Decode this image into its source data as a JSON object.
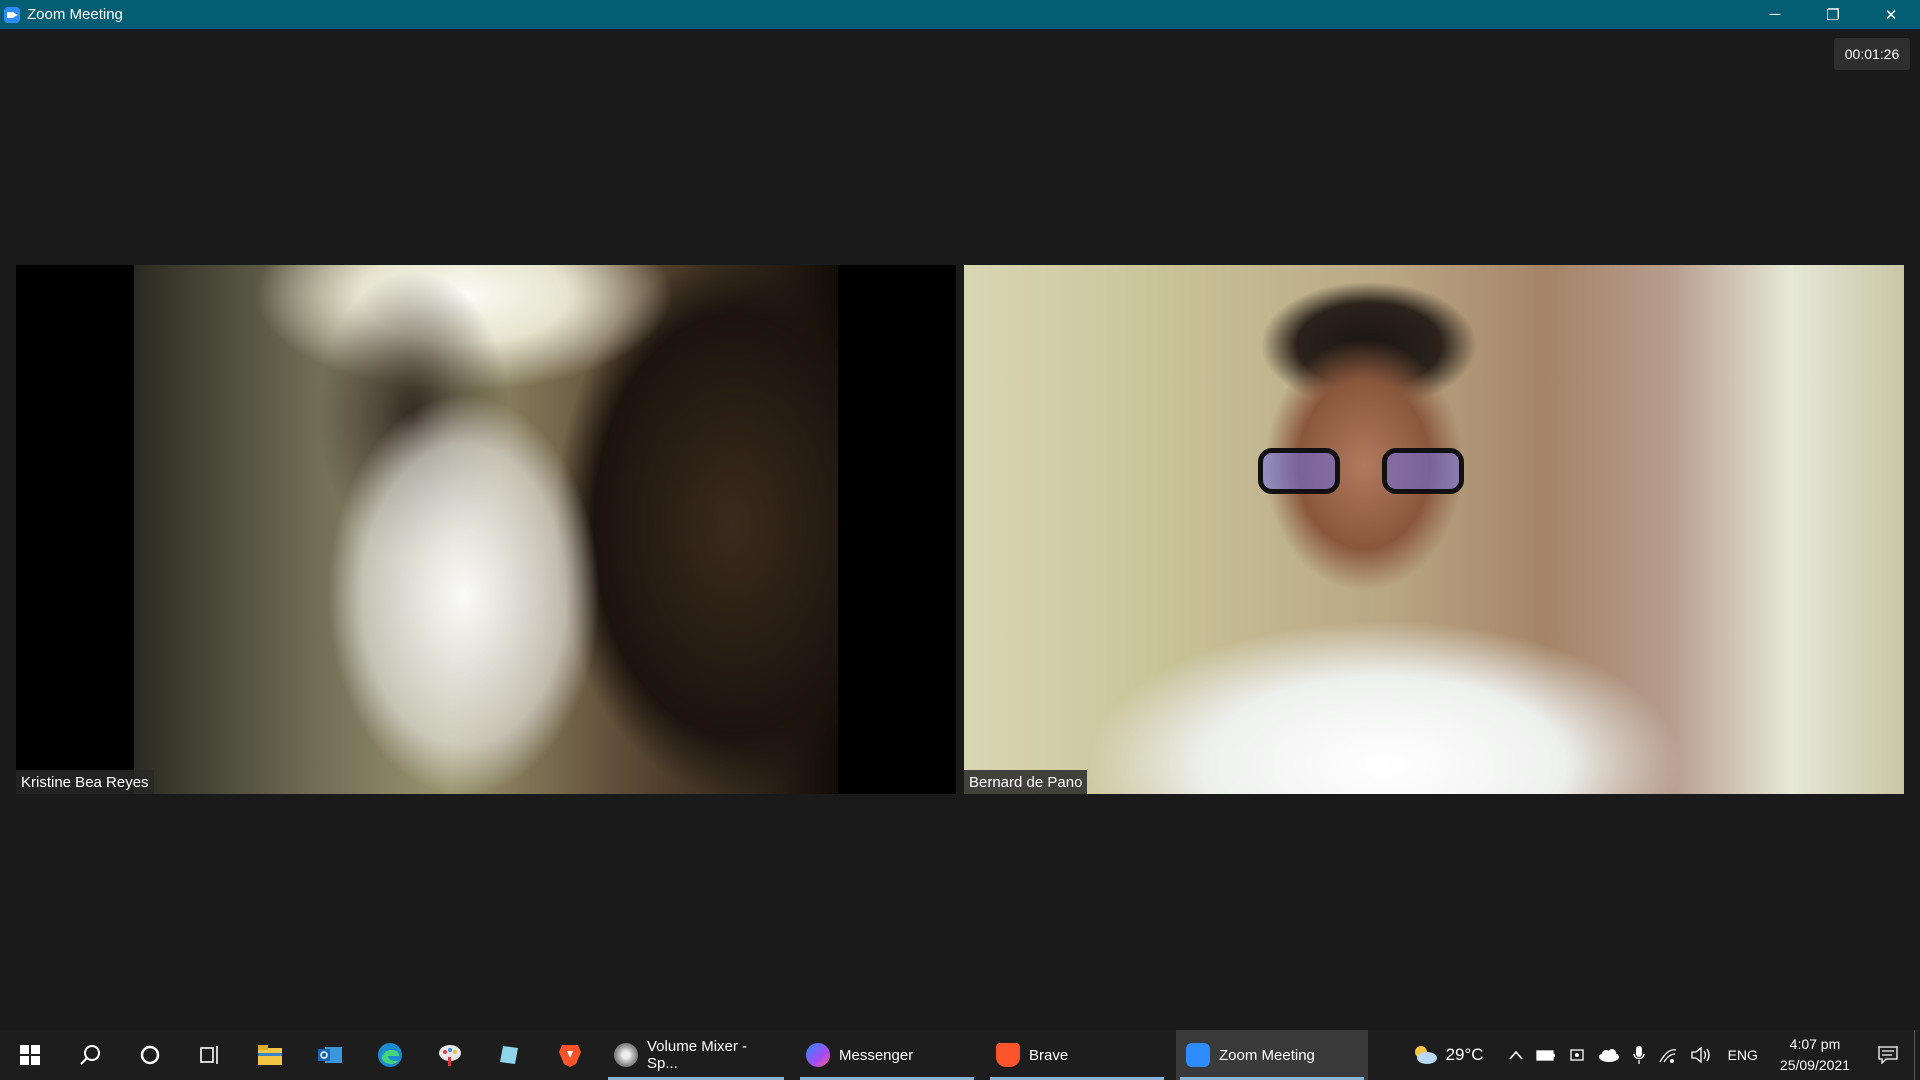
{
  "window": {
    "title": "Zoom Meeting",
    "controls": {
      "minimize": "─",
      "restore": "❐",
      "close": "✕"
    }
  },
  "meeting": {
    "timer": "00:01:26",
    "participants": [
      {
        "name": "Kristine Bea Reyes"
      },
      {
        "name": "Bernard de Pano"
      }
    ]
  },
  "taskbar": {
    "pinned": [
      {
        "name": "windows-start-icon"
      },
      {
        "name": "search-icon"
      },
      {
        "name": "cortana-icon"
      },
      {
        "name": "task-view-icon"
      },
      {
        "name": "file-explorer-icon"
      },
      {
        "name": "outlook-icon"
      },
      {
        "name": "edge-icon"
      },
      {
        "name": "paint-icon"
      },
      {
        "name": "notes-icon"
      },
      {
        "name": "brave-icon"
      }
    ],
    "apps": [
      {
        "label": "Volume Mixer - Sp...",
        "icon": "volume-mixer-icon",
        "color": "#9a9a9a"
      },
      {
        "label": "Messenger",
        "icon": "messenger-icon",
        "color": "#a24cf5"
      },
      {
        "label": "Brave",
        "icon": "brave-icon",
        "color": "#fb542b"
      },
      {
        "label": "Zoom Meeting",
        "icon": "zoom-icon",
        "color": "#2d8cff"
      }
    ],
    "tray": {
      "weather": "29°C",
      "language": "ENG",
      "time": "4:07 pm",
      "date": "25/09/2021"
    }
  }
}
